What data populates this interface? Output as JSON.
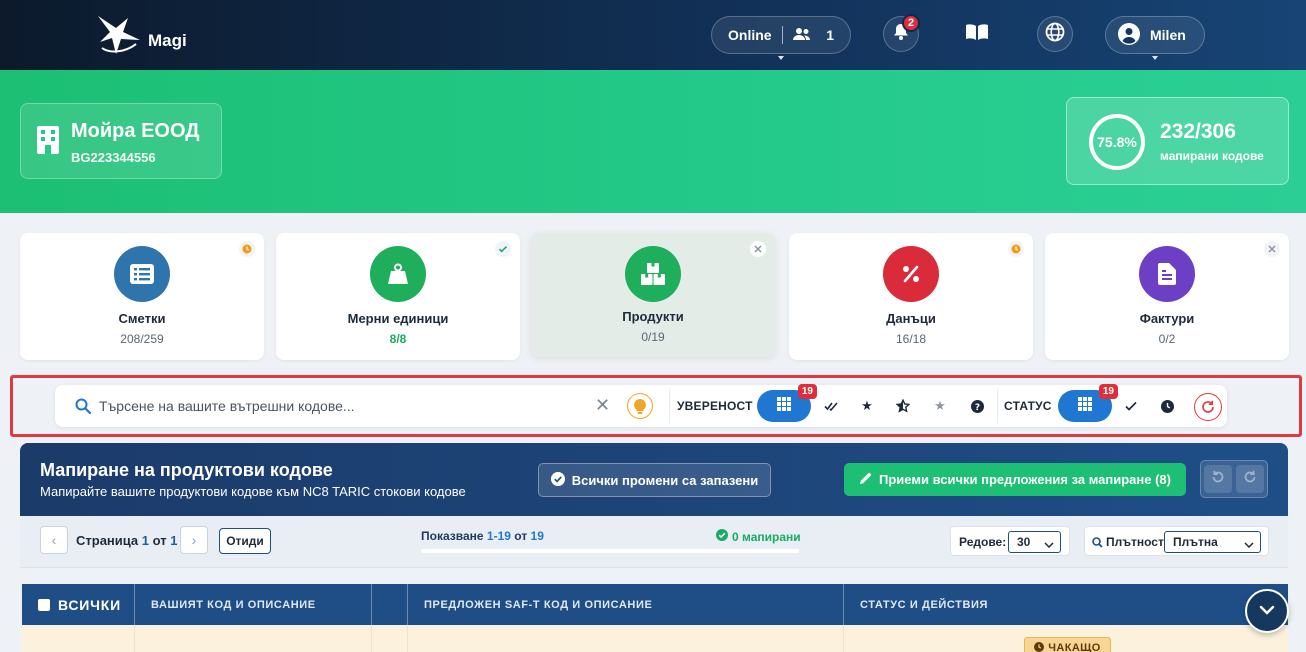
{
  "header": {
    "app_name": "Magi",
    "online_label": "Online",
    "online_count": "1",
    "notifications_count": "2",
    "user_name": "Milen"
  },
  "company": {
    "name": "Мойра ЕООД",
    "vat": "BG223344556"
  },
  "progress": {
    "percent_label": "75.8%",
    "percent": 75.8,
    "count": "232/306",
    "label": "мапирани кодове"
  },
  "steps": [
    {
      "label": "Сметки",
      "value": "208/259",
      "status": "pending"
    },
    {
      "label": "Мерни единици",
      "value": "8/8",
      "status": "done"
    },
    {
      "label": "Продукти",
      "value": "0/19",
      "status": "none"
    },
    {
      "label": "Данъци",
      "value": "16/18",
      "status": "pending"
    },
    {
      "label": "Фактури",
      "value": "0/2",
      "status": "none"
    }
  ],
  "filter": {
    "search_placeholder": "Търсене на вашите вътрешни кодове...",
    "confidence_label": "УВЕРЕНОСТ",
    "confidence_badge": "19",
    "status_label": "СТАТУС",
    "status_badge": "19"
  },
  "mapping": {
    "title": "Мапиране на продуктови кодове",
    "subtitle": "Мапирайте вашите продуктови кодове към NC8 TARIC стокови кодове",
    "saved_label": "Всички промени са запазени",
    "accept_label": "Приеми всички предложения за мапиране (8)"
  },
  "pager": {
    "page_prefix": "Страница",
    "page_current": "1",
    "page_of": "от",
    "page_total": "1",
    "goto_label": "Отиди",
    "showing_prefix": "Показване",
    "showing_range": "1-19",
    "showing_of": "от",
    "showing_total": "19",
    "mapped_label": "0 мапирани",
    "rows_label": "Редове:",
    "rows_value": "30",
    "density_label": "Плътност:",
    "density_value": "Плътна"
  },
  "table": {
    "columns": [
      "ВСИЧКИ",
      "ВАШИЯТ КОД И ОПИСАНИЕ",
      "ПРЕДЛОЖЕН SAF-T КОД И ОПИСАНИЕ",
      "СТАТУС И ДЕЙСТВИЯ"
    ],
    "row_status": "ЧАКАЩО"
  },
  "colors": {
    "accent_blue": "#1f77d1",
    "navy": "#1f4e87",
    "green": "#1cbf73",
    "danger": "#e02d3c",
    "warning": "#f3a526"
  },
  "icons": {
    "steps": [
      "list-icon",
      "weight-icon",
      "boxes-icon",
      "percent-icon",
      "invoice-icon"
    ]
  }
}
